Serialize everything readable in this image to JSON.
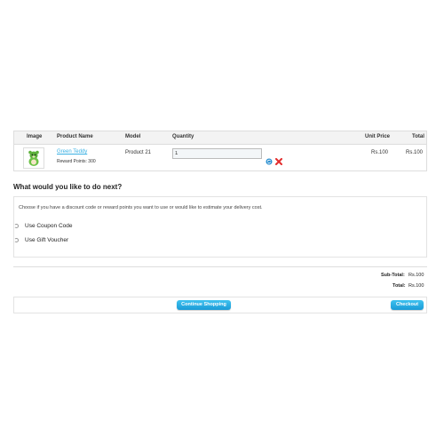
{
  "cart": {
    "columns": {
      "image": "Image",
      "product_name": "Product Name",
      "model": "Model",
      "quantity": "Quantity",
      "unit_price": "Unit Price",
      "total": "Total"
    },
    "items": [
      {
        "name": "Green Teddy",
        "reward_points": "Reward Points: 300",
        "model": "Product 21",
        "quantity": "1",
        "unit_price": "Rs.100",
        "total": "Rs.100",
        "update_icon": "refresh-icon",
        "remove_icon": "remove-icon"
      }
    ]
  },
  "next": {
    "title": "What would you like to do next?",
    "description": "Choose if you have a discount code or reward points you want to use or would like to estimate your delivery cost.",
    "options": [
      {
        "label": "Use Coupon Code"
      },
      {
        "label": "Use Gift Voucher"
      }
    ]
  },
  "totals": {
    "sub_total_label": "Sub-Total:",
    "sub_total_value": "Rs.100",
    "total_label": "Total:",
    "total_value": "Rs.100"
  },
  "buttons": {
    "continue_label": "Continue Shopping",
    "checkout_label": "Checkout"
  },
  "colors": {
    "accent": "#1a9bd7",
    "link": "#38b0e3",
    "remove": "#e22c2c"
  }
}
